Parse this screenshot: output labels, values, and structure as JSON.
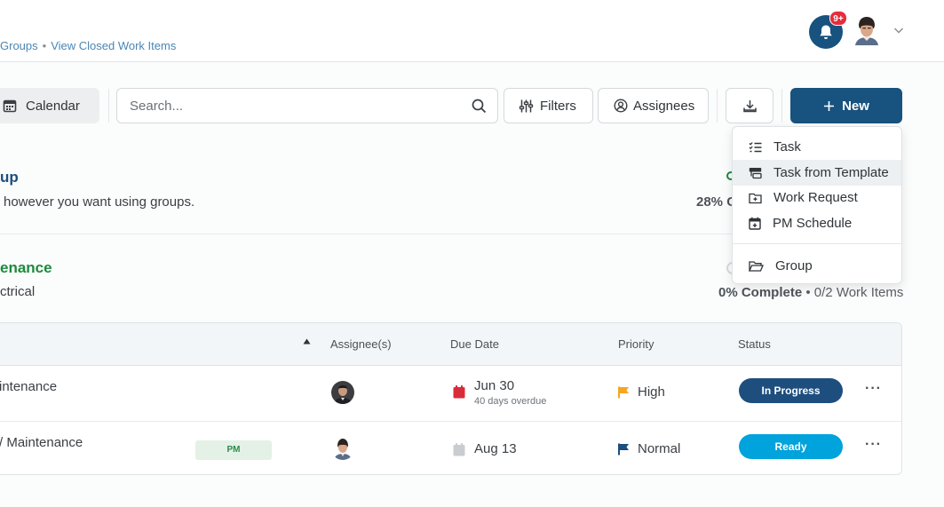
{
  "breadcrumb": {
    "items": [
      "Groups",
      "View Closed Work Items"
    ],
    "separator": "•"
  },
  "header": {
    "notification_badge": "9+"
  },
  "toolbar": {
    "calendar_label": "Calendar",
    "search_placeholder": "Search...",
    "filters_label": "Filters",
    "assignees_label": "Assignees",
    "new_label": "New"
  },
  "dropdown": {
    "items": [
      {
        "label": "Task",
        "icon": "checklist-icon"
      },
      {
        "label": "Task from Template",
        "icon": "template-icon"
      },
      {
        "label": "Work Request",
        "icon": "work-request-icon"
      },
      {
        "label": "PM Schedule",
        "icon": "calendar-plus-icon"
      },
      {
        "label": "Group",
        "icon": "folder-open-icon"
      }
    ]
  },
  "groups": [
    {
      "title": "up",
      "title_color": "#1d4e7e",
      "description": "however you want using groups.",
      "progress": "28% C"
    },
    {
      "title": "enance",
      "title_color": "#1d8a3e",
      "description": "ctrical",
      "progress_percent": "0% Complete",
      "progress_items": "• 0/2 Work Items"
    }
  ],
  "table": {
    "columns": [
      "Assignee(s)",
      "Due Date",
      "Priority",
      "Status"
    ],
    "rows": [
      {
        "name": "intenance",
        "tag": "",
        "due": "Jun 30",
        "due_sub": "40 days overdue",
        "due_overdue": true,
        "priority": "High",
        "priority_color": "#f5a623",
        "status": "In Progress",
        "status_color": "#1d4e7e"
      },
      {
        "name": "/ Maintenance",
        "tag": "PM",
        "due": "Aug 13",
        "due_sub": "",
        "due_overdue": false,
        "priority": "Normal",
        "priority_color": "#1d4e7e",
        "status": "Ready",
        "status_color": "#00a3db"
      }
    ]
  }
}
